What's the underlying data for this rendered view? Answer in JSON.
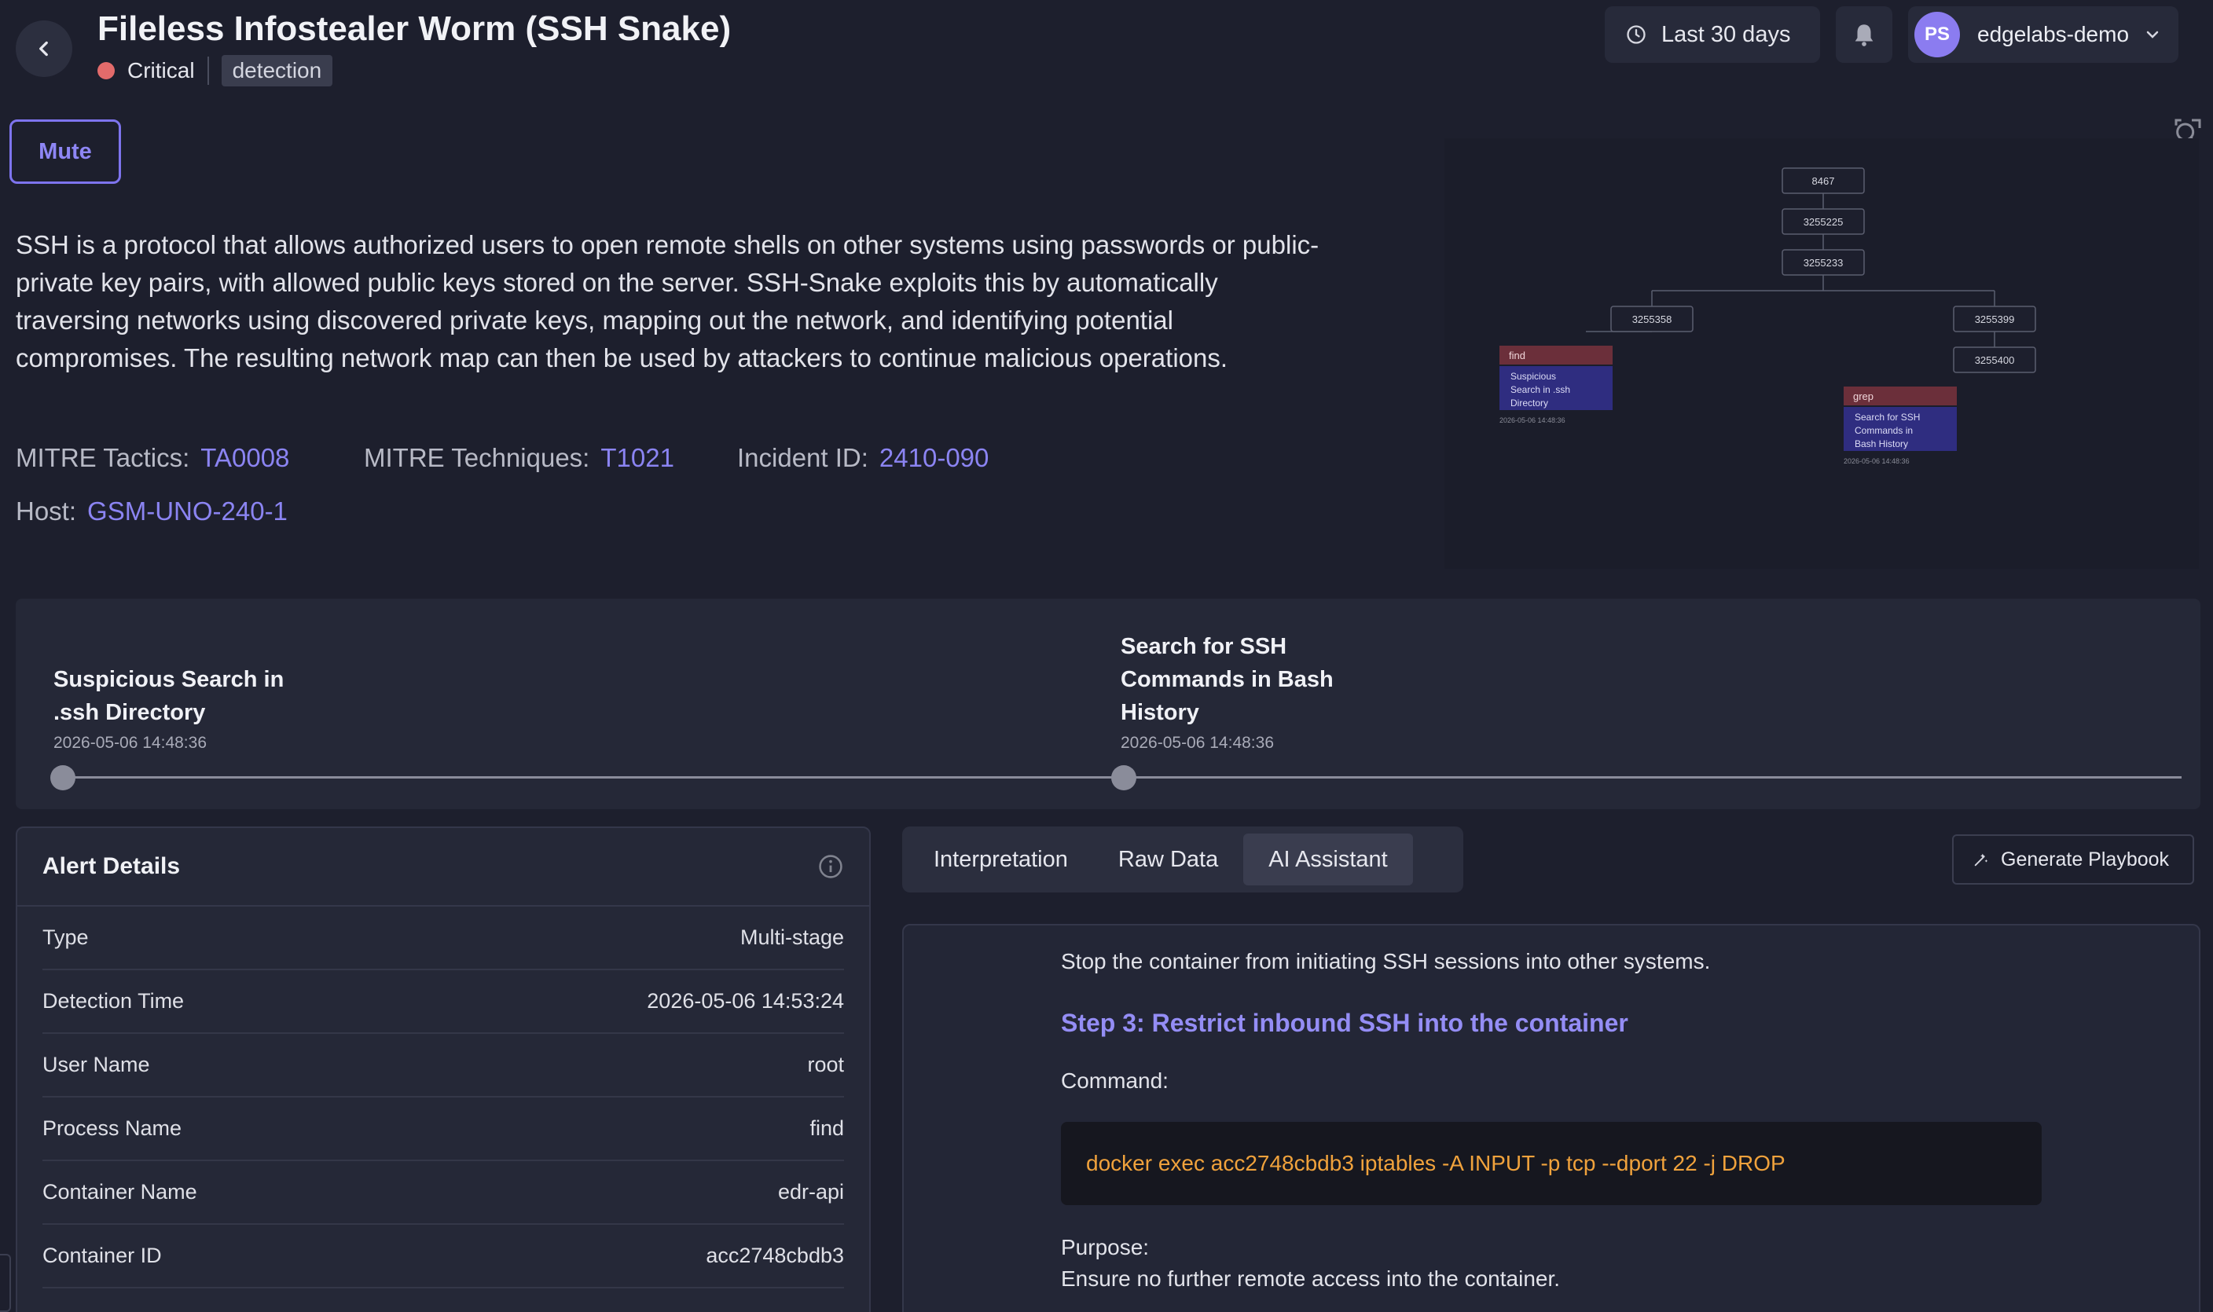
{
  "header": {
    "title": "Fileless Infostealer Worm (SSH Snake)",
    "severity": "Critical",
    "tag": "detection",
    "period": "Last 30 days",
    "user_initials": "PS",
    "user_name": "edgelabs-demo"
  },
  "mute_label": "Mute",
  "description": "SSH is a protocol that allows authorized users to open remote shells on other systems using passwords or public-private key pairs, with allowed public keys stored on the server. SSH-Snake exploits this by automatically traversing networks using discovered private keys, mapping out the network, and identifying potential compromises. The resulting network map can then be used by attackers to continue malicious operations.",
  "meta": {
    "tactics_label": "MITRE Tactics:",
    "tactics_value": "TA0008",
    "techniques_label": "MITRE Techniques:",
    "techniques_value": "T1021",
    "incident_label": "Incident ID:",
    "incident_value": "2410-090",
    "host_label": "Host:",
    "host_value": "GSM-UNO-240-1"
  },
  "graph": {
    "nodes": [
      "8467",
      "3255225",
      "3255233",
      "3255358",
      "3255399",
      "3255400"
    ],
    "left_tag": "find",
    "left_lines": [
      "Suspicious",
      "Search in .ssh",
      "Directory"
    ],
    "left_time": "2026-05-06 14:48:36",
    "right_tag": "grep",
    "right_lines": [
      "Search for SSH",
      "Commands in",
      "Bash History"
    ],
    "right_time": "2026-05-06 14:48:36"
  },
  "timeline": {
    "events": [
      {
        "title_lines": [
          "Suspicious Search in",
          ".ssh Directory"
        ],
        "time": "2026-05-06 14:48:36"
      },
      {
        "title_lines": [
          "Search for SSH",
          "Commands in Bash",
          "History"
        ],
        "time": "2026-05-06 14:48:36"
      }
    ]
  },
  "alert": {
    "title": "Alert Details",
    "rows": [
      {
        "k": "Type",
        "v": "Multi-stage"
      },
      {
        "k": "Detection Time",
        "v": "2026-05-06 14:53:24"
      },
      {
        "k": "User Name",
        "v": "root"
      },
      {
        "k": "Process Name",
        "v": "find"
      },
      {
        "k": "Container Name",
        "v": "edr-api"
      },
      {
        "k": "Container ID",
        "v": "acc2748cbdb3"
      }
    ]
  },
  "tabs": [
    "Interpretation",
    "Raw Data",
    "AI Assistant"
  ],
  "generate_label": "Generate Playbook",
  "ai": {
    "intro": "Stop the container from initiating SSH sessions into other systems.",
    "step": "Step 3: Restrict inbound SSH into the container",
    "command_label": "Command:",
    "command": "docker exec acc2748cbdb3 iptables -A INPUT -p tcp --dport 22 -j DROP",
    "purpose_label": "Purpose:",
    "purpose": "Ensure no further remote access into the container."
  },
  "colors": {
    "accent": "#8b84f2",
    "critical": "#e36b6b",
    "code": "#f0a23c"
  }
}
